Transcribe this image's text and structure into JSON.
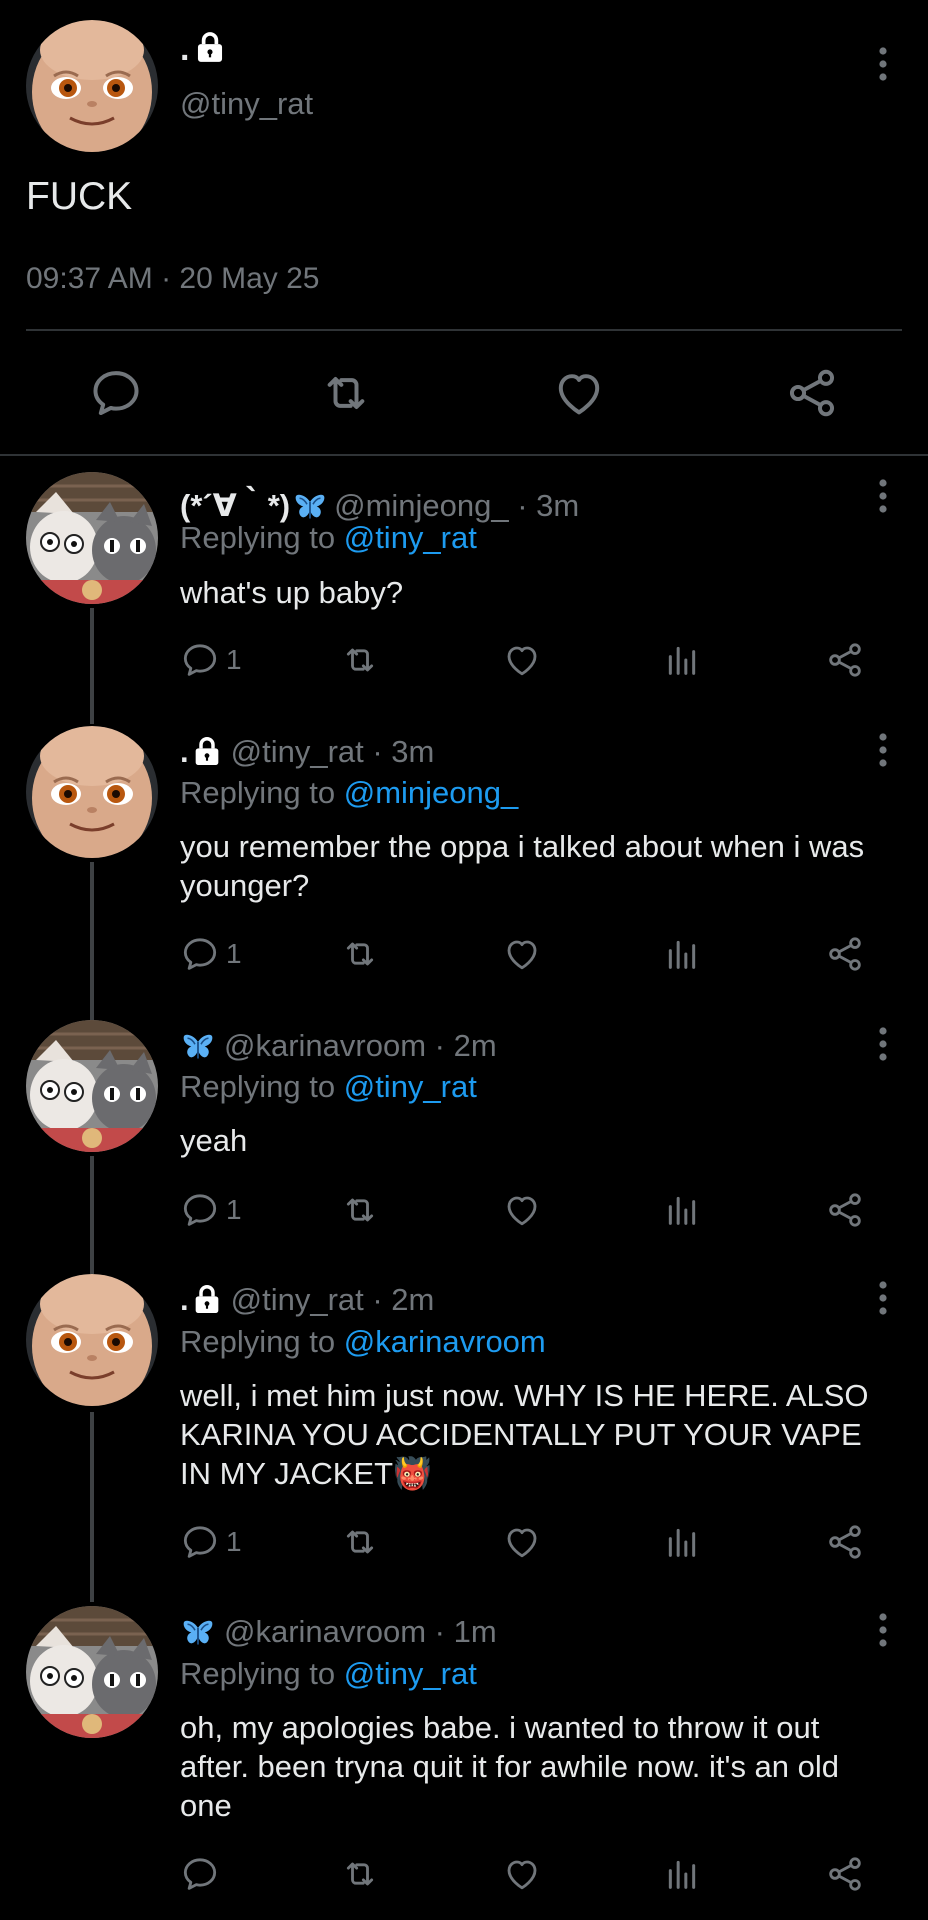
{
  "main_post": {
    "display_name": ".",
    "handle": "@tiny_rat",
    "text": "FUCK",
    "timestamp": "09:37 AM · 20 May 25"
  },
  "replies": [
    {
      "display_name": "(*´∀｀*)",
      "handle": "@minjeong_ · 3m",
      "reply_prefix": "Replying to ",
      "reply_to": "@tiny_rat",
      "text": "what's up baby?",
      "reply_count": "1"
    },
    {
      "display_name": ".",
      "handle": "@tiny_rat · 3m",
      "reply_prefix": "Replying to ",
      "reply_to": "@minjeong_",
      "text": "you remember the oppa i talked about when i was younger?",
      "reply_count": "1"
    },
    {
      "display_name": "",
      "handle": "@karinavroom · 2m",
      "reply_prefix": "Replying to ",
      "reply_to": "@tiny_rat",
      "text": "yeah",
      "reply_count": "1"
    },
    {
      "display_name": ".",
      "handle": "@tiny_rat · 2m",
      "reply_prefix": "Replying to ",
      "reply_to": "@karinavroom",
      "text": "well, i met him just now. WHY IS HE HERE. ALSO KARINA YOU ACCIDENTALLY PUT YOUR VAPE IN MY JACKET👹",
      "reply_count": "1"
    },
    {
      "display_name": "",
      "handle": "@karinavroom · 1m",
      "reply_prefix": "Replying to ",
      "reply_to": "@tiny_rat",
      "text": "oh, my apologies babe. i wanted to throw it out after. been tryna quit it for awhile now. it's an old one",
      "reply_count": ""
    }
  ],
  "icons": {
    "reply": "reply-icon",
    "retweet": "retweet-icon",
    "like": "heart-icon",
    "views": "views-icon",
    "share": "share-icon",
    "lock": "lock-icon",
    "butterfly": "butterfly-icon",
    "more": "more-vertical-icon"
  },
  "colors": {
    "background": "#000000",
    "text": "#e7e9ea",
    "secondary": "#71767b",
    "link": "#1d9bf0"
  }
}
